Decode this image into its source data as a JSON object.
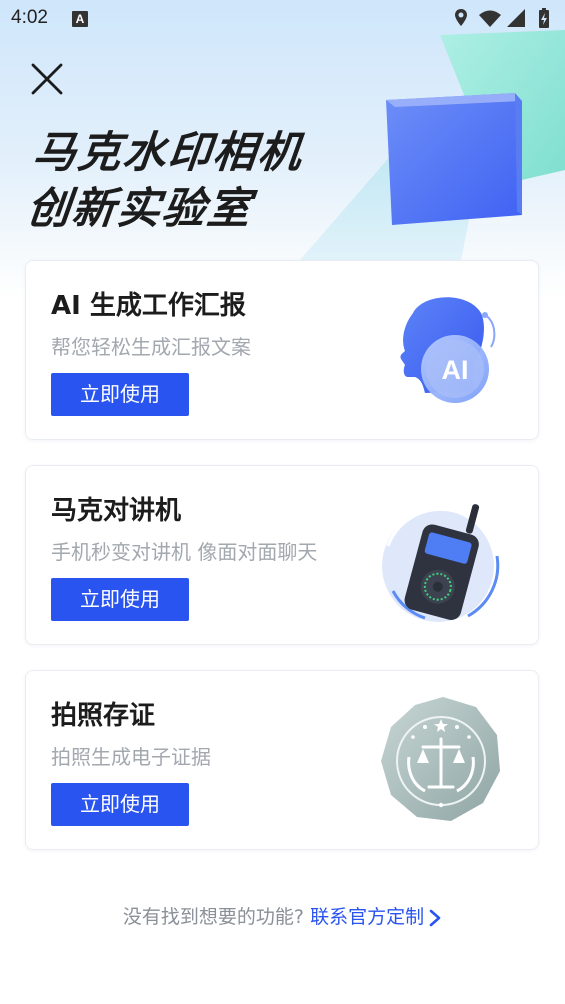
{
  "status_bar": {
    "time": "4:02",
    "notification_letter": "A"
  },
  "hero": {
    "title_line1": "马克水印相机",
    "title_line2": "创新实验室"
  },
  "cards": [
    {
      "title": "AI 生成工作汇报",
      "subtitle": "帮您轻松生成汇报文案",
      "button": "立即使用",
      "icon": "ai-head-icon",
      "badge": "AI"
    },
    {
      "title": "马克对讲机",
      "subtitle": "手机秒变对讲机 像面对面聊天",
      "button": "立即使用",
      "icon": "walkie-talkie-icon"
    },
    {
      "title": "拍照存证",
      "subtitle": "拍照生成电子证据",
      "button": "立即使用",
      "icon": "justice-badge-icon"
    }
  ],
  "footer": {
    "text": "没有找到想要的功能?",
    "link": "联系官方定制"
  },
  "colors": {
    "accent": "#2a54f0",
    "title": "#1c1c1c",
    "subtitle": "#a3a8af",
    "footer_text": "#8a9097"
  }
}
